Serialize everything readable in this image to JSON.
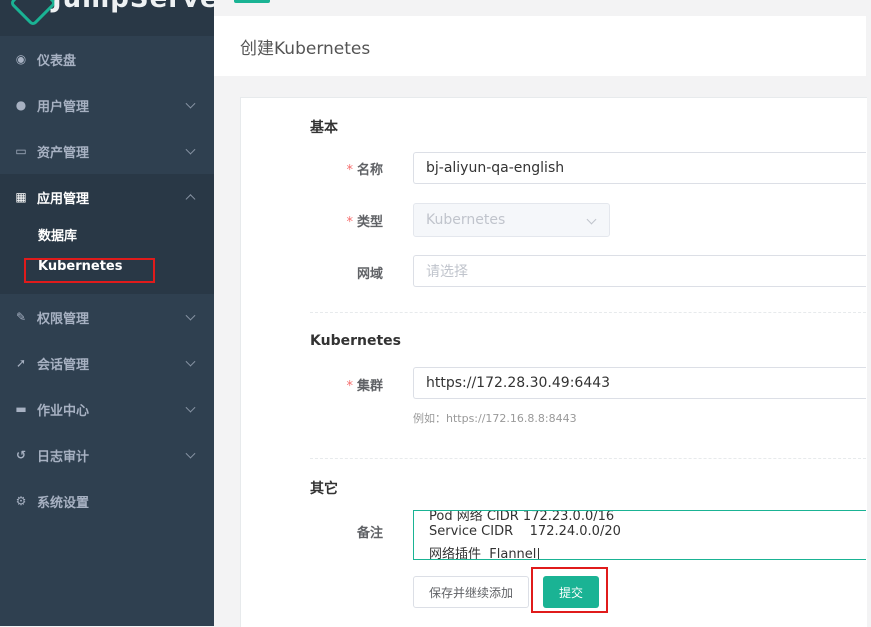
{
  "app": {
    "logo_text": "JumpServer"
  },
  "sidebar": {
    "items": [
      {
        "label": "仪表盘",
        "icon": "dashboard-icon"
      },
      {
        "label": "用户管理",
        "icon": "users-icon"
      },
      {
        "label": "资产管理",
        "icon": "inbox-icon"
      },
      {
        "label": "应用管理",
        "icon": "grid-icon"
      },
      {
        "label": "权限管理",
        "icon": "edit-icon"
      },
      {
        "label": "会话管理",
        "icon": "rocket-icon"
      },
      {
        "label": "作业中心",
        "icon": "coffee-icon"
      },
      {
        "label": "日志审计",
        "icon": "history-icon"
      },
      {
        "label": "系统设置",
        "icon": "gears-icon"
      }
    ],
    "subitems": [
      {
        "label": "数据库"
      },
      {
        "label": "Kubernetes"
      }
    ]
  },
  "header": {
    "title": "创建Kubernetes"
  },
  "form": {
    "section_basic": "基本",
    "name_label": "名称",
    "name_value": "bj-aliyun-qa-english",
    "type_label": "类型",
    "type_value": "Kubernetes",
    "domain_label": "网域",
    "domain_placeholder": "请选择",
    "section_k8s": "Kubernetes",
    "cluster_label": "集群",
    "cluster_value": "https://172.28.30.49:6443",
    "cluster_hint": "例如：https://172.16.8.8:8443",
    "section_other": "其它",
    "comment_label": "备注",
    "comment_lines": [
      "Pod 网络 CIDR 172.23.0.0/16",
      "Service CIDR    172.24.0.0/20",
      "网络插件  Flannel"
    ],
    "required_mark": "*",
    "btn_save_continue": "保存并继续添加",
    "btn_submit": "提交"
  },
  "colors": {
    "sidebar_bg": "#2f4050",
    "accent": "#1ab394",
    "highlight_box": "#e01b1b"
  }
}
